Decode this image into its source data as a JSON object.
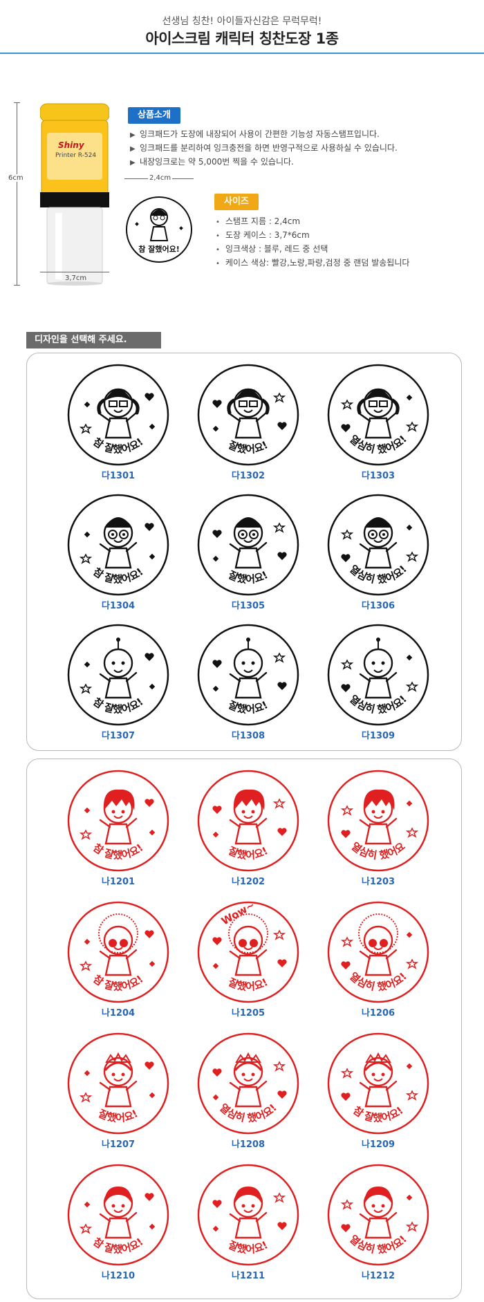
{
  "header": {
    "subtitle": "선생님 칭찬! 아이들자신감은 무럭무럭!",
    "title": "아이스크림 캐릭터 칭찬도장 1종"
  },
  "product": {
    "height_label": "6cm",
    "width_label": "3,7cm",
    "diameter_label": "2,4cm",
    "brand": "Shiny",
    "model": "Printer R-524",
    "sample_text": "참 잘했어요!"
  },
  "intro": {
    "label": "상품소개",
    "items": [
      "잉크패드가 도장에 내장되어 사용이 간편한 기능성 자동스탬프입니다.",
      "잉크패드를 분리하여 잉크충전을 하면 반영구적으로 사용하실 수 있습니다.",
      "내장잉크로는 약 5,000번 찍을 수 있습니다."
    ]
  },
  "size": {
    "label": "사이즈",
    "items": [
      "스탬프 지름 : 2,4cm",
      "도장 케이스 : 3,7*6cm",
      "잉크색상 : 블루, 레드 중 선택",
      "케이스 색상:  빨강,노랑,파랑,검정 중 랜덤 발송됩니다"
    ]
  },
  "design_label": "디자인을 선택해 주세요.",
  "colors": {
    "accent_blue": "#2766b6",
    "header_rule": "#3a8fd6",
    "intro_label": "#1e6fc6",
    "size_label": "#f0a816",
    "stamp_black": "#111111",
    "stamp_red": "#e02020"
  },
  "black_stamps": [
    {
      "code": "다1301",
      "text": "참 잘했어요!",
      "icon": "girl-glasses-fist-icon"
    },
    {
      "code": "다1302",
      "text": "잘했어요!",
      "icon": "girl-glasses-hearts-icon"
    },
    {
      "code": "다1303",
      "text": "열심히 했어요!",
      "icon": "girl-glasses-stars-icon"
    },
    {
      "code": "다1304",
      "text": "참 잘했어요!",
      "icon": "boy-spiral-eyes-thumbsup-icon"
    },
    {
      "code": "다1305",
      "text": "잘했어요!",
      "icon": "boy-heart-eyes-icon"
    },
    {
      "code": "다1306",
      "text": "열심히 했어요!",
      "icon": "boy-spiral-eyes-bee-icon"
    },
    {
      "code": "다1307",
      "text": "참 잘했어요!",
      "icon": "ghost-trophy-icon"
    },
    {
      "code": "다1308",
      "text": "잘했어요!",
      "icon": "alien-antenna-icon"
    },
    {
      "code": "다1309",
      "text": "열심히 했어요!",
      "icon": "alien-flags-icon"
    }
  ],
  "red_stamps": [
    {
      "code": "나1201",
      "text": "참 잘했어요!",
      "icon": "boy-victory-sign-icon"
    },
    {
      "code": "나1202",
      "text": "잘했어요!",
      "icon": "boy-dancing-icon"
    },
    {
      "code": "나1203",
      "text": "열심히 했어요",
      "icon": "boy-headphones-icon"
    },
    {
      "code": "나1204",
      "text": "참 잘했어요!",
      "icon": "afro-thumbsup-icon"
    },
    {
      "code": "나1205",
      "text": "잘했어요!",
      "icon": "afro-wow-icon"
    },
    {
      "code": "나1206",
      "text": "열심히 했어요!",
      "icon": "afro-singing-icon"
    },
    {
      "code": "나1207",
      "text": "잘했어요!",
      "icon": "princess-wink-icon"
    },
    {
      "code": "나1208",
      "text": "열심히 했어요!",
      "icon": "princess-harp-icon"
    },
    {
      "code": "나1209",
      "text": "참 잘했어요!",
      "icon": "princess-heart-icon"
    },
    {
      "code": "나1210",
      "text": "참 잘했어요!",
      "icon": "girl-thumbsup-icon"
    },
    {
      "code": "나1211",
      "text": "잘했어요!",
      "icon": "girl-jumping-icon"
    },
    {
      "code": "나1212",
      "text": "열심히 했어요!",
      "icon": "girl-cheerleader-icon"
    }
  ],
  "wow_text": "Wow~"
}
